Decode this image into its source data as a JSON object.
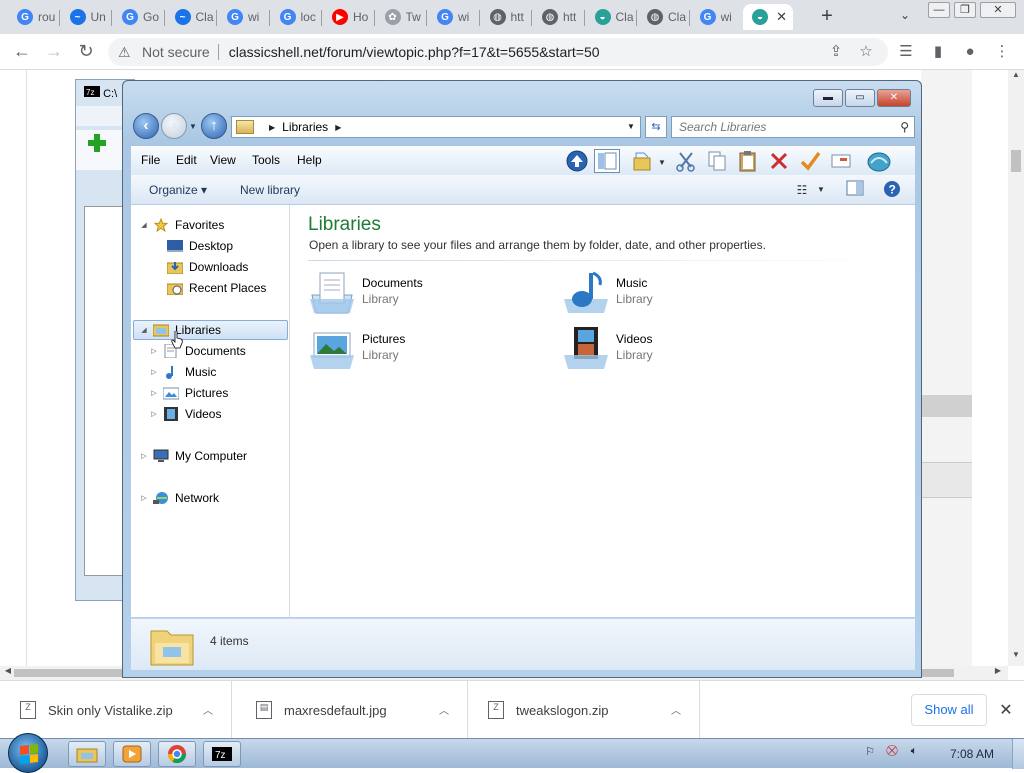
{
  "browser": {
    "tabs": [
      {
        "label": "rou",
        "icon": "google-icon",
        "color": "#4285f4",
        "glyph": "G"
      },
      {
        "label": "Un",
        "icon": "classicshell-icon",
        "color": "#1a73e8",
        "glyph": "~"
      },
      {
        "label": "Go",
        "icon": "google-icon",
        "color": "#4285f4",
        "glyph": "G"
      },
      {
        "label": "Cla",
        "icon": "classicshell-icon",
        "color": "#1a73e8",
        "glyph": "~"
      },
      {
        "label": "wi",
        "icon": "google-icon",
        "color": "#4285f4",
        "glyph": "G"
      },
      {
        "label": "loc",
        "icon": "google-icon",
        "color": "#4285f4",
        "glyph": "G"
      },
      {
        "label": "Ho",
        "icon": "youtube-icon",
        "color": "#ff0000",
        "glyph": "▶"
      },
      {
        "label": "Tw",
        "icon": "tweaks-icon",
        "color": "#9aa0a6",
        "glyph": "✿"
      },
      {
        "label": "wi",
        "icon": "google-icon",
        "color": "#4285f4",
        "glyph": "G"
      },
      {
        "label": "htt",
        "icon": "globe-icon",
        "color": "#5f6368",
        "glyph": "◍"
      },
      {
        "label": "htt",
        "icon": "globe-icon",
        "color": "#5f6368",
        "glyph": "◍"
      },
      {
        "label": "Cla",
        "icon": "classicshell-icon",
        "color": "#2aa198",
        "glyph": "◒"
      },
      {
        "label": "Cla",
        "icon": "globe-icon",
        "color": "#5f6368",
        "glyph": "◍"
      },
      {
        "label": "wi",
        "icon": "google-icon",
        "color": "#4285f4",
        "glyph": "G"
      },
      {
        "label": "",
        "icon": "classicshell-icon",
        "color": "#2aa198",
        "glyph": "◒"
      }
    ],
    "new_tab": "+",
    "tab_search": "⌄",
    "window_buttons": {
      "minimize": "—",
      "restore": "❐",
      "close": "✕"
    },
    "toolbar": {
      "back": "←",
      "forward": "→",
      "reload": "↻"
    },
    "address": {
      "warning_icon": "⚠",
      "security": "Not secure",
      "url": "classicshell.net/forum/viewtopic.php?f=17&t=5655&start=50"
    },
    "right_icons": {
      "share": "⇪",
      "bookmark": "☆",
      "reading": "☰",
      "sidepanel": "▮",
      "profile": "●",
      "menu": "⋮"
    }
  },
  "zip_window": {
    "title_prefix": "C:\\"
  },
  "explorer": {
    "caption": {
      "minimize": "▬",
      "maximize": "▭",
      "close": "✕"
    },
    "breadcrumb": [
      "Libraries"
    ],
    "search_placeholder": "Search Libraries",
    "menu": [
      "File",
      "Edit",
      "View",
      "Tools",
      "Help"
    ],
    "commands": {
      "organize": "Organize ▾",
      "new_library": "New library"
    },
    "nav": {
      "favorites": "Favorites",
      "favorites_items": [
        "Desktop",
        "Downloads",
        "Recent Places"
      ],
      "libraries": "Libraries",
      "libraries_items": [
        "Documents",
        "Music",
        "Pictures",
        "Videos"
      ],
      "computer": "My Computer",
      "network": "Network"
    },
    "content": {
      "title": "Libraries",
      "subtitle": "Open a library to see your files and arrange them by folder, date, and other properties.",
      "tiles": [
        {
          "name": "Documents",
          "type": "Library"
        },
        {
          "name": "Music",
          "type": "Library"
        },
        {
          "name": "Pictures",
          "type": "Library"
        },
        {
          "name": "Videos",
          "type": "Library"
        }
      ]
    },
    "details": {
      "count": "4 items"
    }
  },
  "downloads": {
    "items": [
      {
        "name": "Skin only Vistalike.zip"
      },
      {
        "name": "maxresdefault.jpg"
      },
      {
        "name": "tweakslogon.zip"
      }
    ],
    "show_all": "Show all",
    "close": "✕"
  },
  "taskbar": {
    "clock": "7:08 AM"
  }
}
